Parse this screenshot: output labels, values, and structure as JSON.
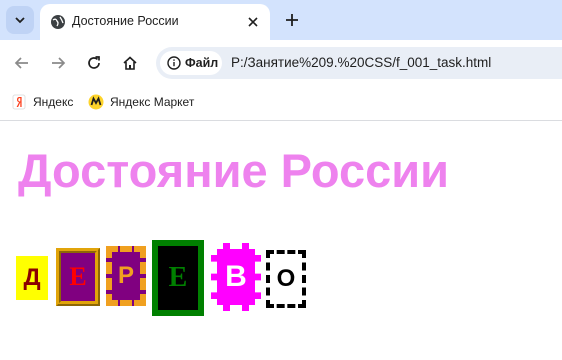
{
  "browser": {
    "tab_title": "Достояние России",
    "new_tab_symbol": "+",
    "close_symbol": "✕",
    "site_chip_label": "Файл",
    "url": "P:/Занятие%209.%20CSS/f_001_task.html",
    "bookmarks": [
      {
        "label": "Яндекс",
        "icon": "yandex-icon"
      },
      {
        "label": "Яндекс Маркет",
        "icon": "yandex-market-icon"
      }
    ]
  },
  "page": {
    "title": "Достояние России",
    "title_color": "#ee82ee",
    "letters": [
      "Д",
      "Е",
      "Р",
      "Е",
      "В",
      "О"
    ]
  }
}
